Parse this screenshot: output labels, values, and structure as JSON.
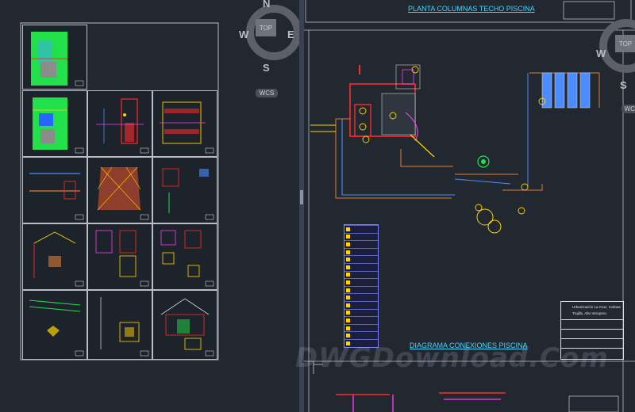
{
  "viewcube_left": {
    "top": "TOP",
    "north": "N",
    "east": "E",
    "south": "S",
    "west": "W",
    "wcs": "WCS"
  },
  "viewcube_right": {
    "top": "TOP",
    "west": "W",
    "south": "S",
    "wcs": "WCS"
  },
  "drawing": {
    "title_main": "PLANTA COLUMNAS TECHO PISCINA",
    "title_diagram": "DIAGRAMA CONEXIONES PISCINA",
    "watermark": "DWGDownload.Com"
  },
  "title_block": {
    "line1": "Urbanización La Cruz, Colinas",
    "line2": "Trujillo, Alto Veropero."
  },
  "legend": {
    "rows": 16
  },
  "colors": {
    "background": "#212830",
    "frame": "#b8bec8",
    "cyan": "#46d6ff",
    "yellow": "#ffd400",
    "red": "#ff2a2a",
    "blue": "#4b8cff",
    "orange": "#e07a35"
  }
}
